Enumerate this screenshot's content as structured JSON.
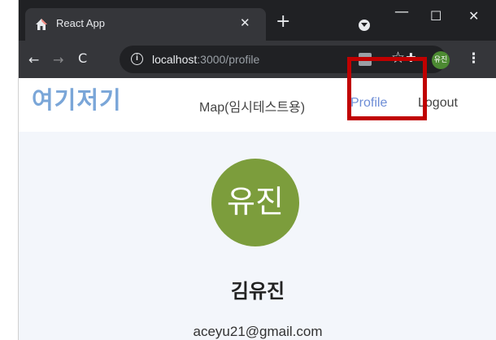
{
  "browser": {
    "tab": {
      "title": "React App",
      "close_glyph": "✕",
      "favicon": "house-icon"
    },
    "new_tab_glyph": "+",
    "window_controls": {
      "minimize_glyph": "—",
      "maximize_glyph": "☐",
      "close_glyph": "✕"
    },
    "nav": {
      "back_glyph": "←",
      "forward_glyph": "→",
      "reload_glyph": "C"
    },
    "address": {
      "info_glyph": "i",
      "host": "localhost",
      "rest": ":3000/profile"
    },
    "star_glyph": "☆",
    "extensions_glyph": "✚",
    "profile_initials": "유진",
    "menu_glyph": "⋮"
  },
  "app": {
    "logo": "여기저기",
    "nav": {
      "map": "Map(임시테스트용)",
      "profile": "Profile",
      "logout": "Logout"
    },
    "profile": {
      "avatar_text": "유진",
      "name": "김유진",
      "email": "aceyu21@gmail.com"
    }
  },
  "colors": {
    "accent_link": "#6d8dd6",
    "avatar": "#7c9d3c",
    "highlight": "#c00000",
    "logo": "#7aa6d8"
  }
}
